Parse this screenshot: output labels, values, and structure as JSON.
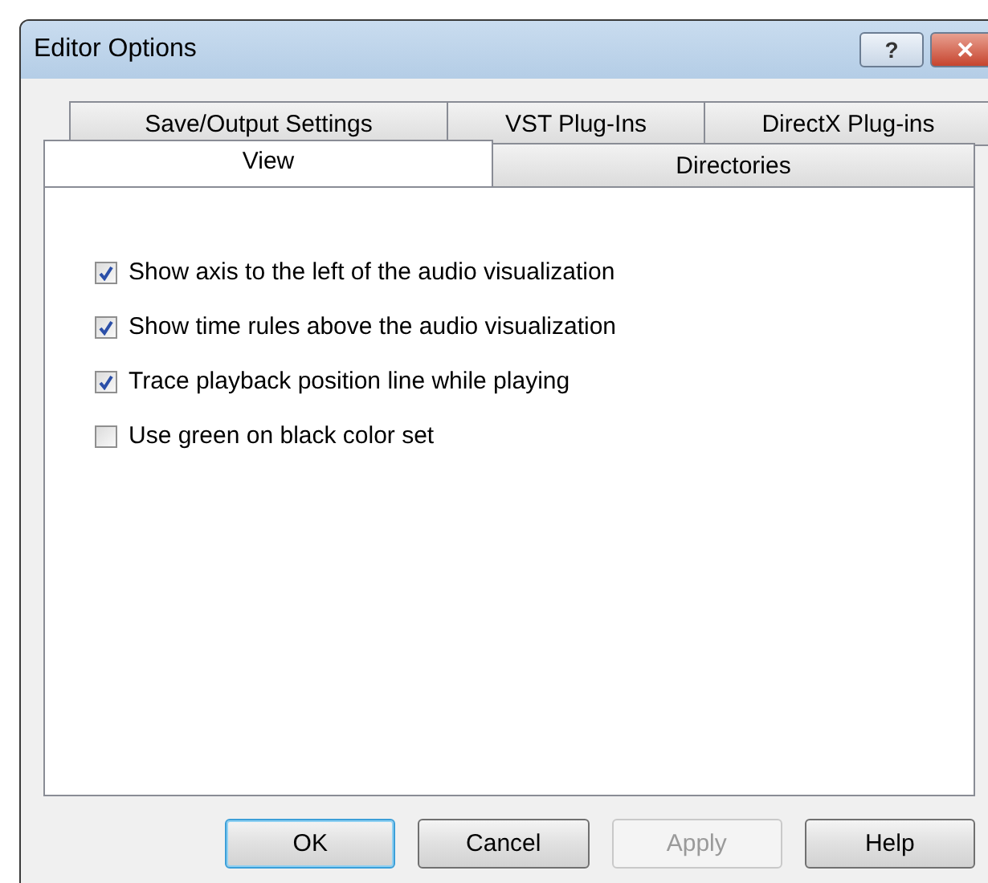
{
  "window": {
    "title": "Editor Options",
    "help_button": "?",
    "close_button": "✕"
  },
  "tab_rows": [
    [
      {
        "label": "Save/Output Settings",
        "selected": false
      },
      {
        "label": "VST Plug-Ins",
        "selected": false
      },
      {
        "label": "DirectX Plug-ins",
        "selected": false
      }
    ],
    [
      {
        "label": "View",
        "selected": true
      },
      {
        "label": "Directories",
        "selected": false
      }
    ]
  ],
  "options": [
    {
      "label": "Show axis to the left of the audio visualization",
      "checked": true
    },
    {
      "label": "Show time rules above the audio visualization",
      "checked": true
    },
    {
      "label": "Trace playback position line while playing",
      "checked": true
    },
    {
      "label": "Use green on black color set",
      "checked": false
    }
  ],
  "buttons": [
    {
      "label": "OK",
      "default": true,
      "disabled": false
    },
    {
      "label": "Cancel",
      "default": false,
      "disabled": false
    },
    {
      "label": "Apply",
      "default": false,
      "disabled": true
    },
    {
      "label": "Help",
      "default": false,
      "disabled": false
    }
  ]
}
